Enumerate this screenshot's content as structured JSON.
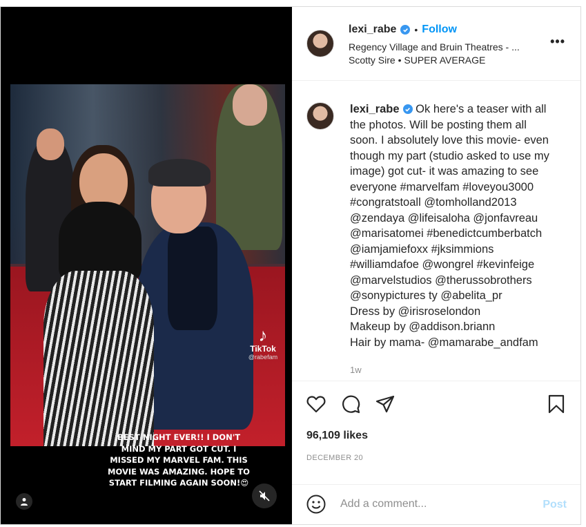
{
  "post": {
    "author": {
      "username": "lexi_rabe",
      "verified": true,
      "separator": "•",
      "follow_label": "Follow",
      "location": "Regency Village and Bruin Theatres - ...",
      "audio": "Scotty Sire • SUPER AVERAGE"
    },
    "more_icon": "more-horizontal-icon",
    "media": {
      "overlay_caption": "Best night ever!! I don't mind my part got cut. I missed my Marvel fam. This movie was amazing. Hope to start filming again soon!😍",
      "tiktok": {
        "brand": "TikTok",
        "handle": "@rabefam"
      },
      "user_tag_icon": "user-tag-icon",
      "mute_icon": "volume-muted-icon"
    },
    "caption": {
      "username": "lexi_rabe",
      "lines": [
        "Ok here's a teaser with all",
        "the photos. Will be posting them all",
        "soon. I absolutely love this movie- even",
        "though my part (studio asked to use my",
        "image) got cut- it was amazing to see",
        "everyone #marvelfam #loveyou3000",
        "#congratstoall @tomholland2013",
        "@zendaya @lifeisaloha @jonfavreau",
        "@marisatomei #benedictcumberbatch",
        "@iamjamiefoxx #jksimmions",
        "#williamdafoe @wongrel #kevinfeige",
        "@marvelstudios @therussobrothers",
        "@sonypictures ty @abelita_pr",
        "Dress by @irisroselondon",
        "Makeup by @addison.briann",
        "Hair by mama- @mamarabe_andfam"
      ],
      "time": "1w"
    },
    "actions": {
      "like_icon": "heart-icon",
      "comment_icon": "comment-icon",
      "share_icon": "share-icon",
      "save_icon": "bookmark-icon"
    },
    "likes": "96,109 likes",
    "date": "DECEMBER 20",
    "comment_box": {
      "emoji_icon": "emoji-icon",
      "placeholder": "Add a comment...",
      "post_label": "Post"
    }
  },
  "colors": {
    "accent": "#0095f6",
    "verified": "#3897f0",
    "muted_text": "#8e8e8e",
    "post_disabled": "#b2dffc"
  }
}
